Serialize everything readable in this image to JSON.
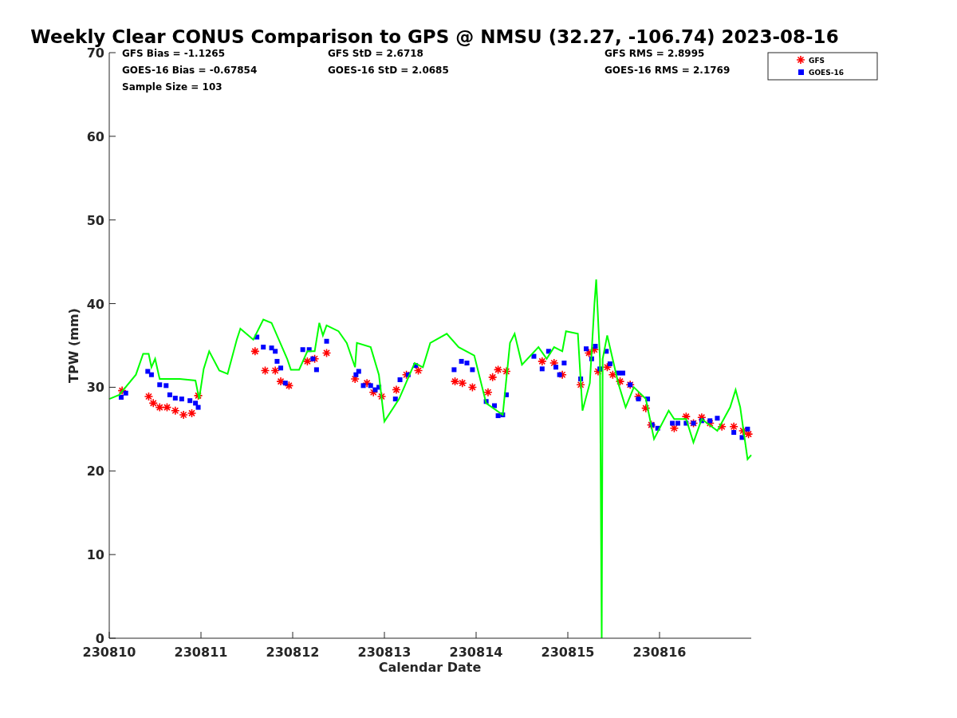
{
  "chart_data": {
    "type": "scatter",
    "title": "Weekly Clear CONUS Comparison to GPS @ NMSU (32.27, -106.74) 2023-08-16",
    "xlabel": "Calendar Date",
    "ylabel": "TPW (mm)",
    "xlim": [
      230810,
      230817
    ],
    "ylim": [
      0,
      70
    ],
    "xticks": [
      {
        "value": 230810,
        "label": "230810"
      },
      {
        "value": 230811,
        "label": "230811"
      },
      {
        "value": 230812,
        "label": "230812"
      },
      {
        "value": 230813,
        "label": "230813"
      },
      {
        "value": 230814,
        "label": "230814"
      },
      {
        "value": 230815,
        "label": "230815"
      },
      {
        "value": 230816,
        "label": "230816"
      }
    ],
    "yticks": [
      0,
      10,
      20,
      30,
      40,
      50,
      60,
      70
    ],
    "series": [
      {
        "name": "GFS",
        "type": "scatter",
        "color": "#ff0000",
        "x": [
          230810.14,
          230810.43,
          230810.48,
          230810.55,
          230810.63,
          230810.72,
          230810.81,
          230810.9,
          230810.97,
          230811.59,
          230811.7,
          230811.81,
          230811.87,
          230811.96,
          230812.16,
          230812.24,
          230812.37,
          230812.68,
          230812.81,
          230812.88,
          230812.97,
          230813.13,
          230813.24,
          230813.37,
          230813.77,
          230813.85,
          230813.96,
          230814.13,
          230814.18,
          230814.24,
          230814.33,
          230814.72,
          230814.85,
          230814.94,
          230815.14,
          230815.23,
          230815.29,
          230815.33,
          230815.43,
          230815.49,
          230815.57,
          230815.68,
          230815.77,
          230815.85,
          230815.91,
          230816.16,
          230816.29,
          230816.37,
          230816.46,
          230816.55,
          230816.68,
          230816.81,
          230816.91,
          230816.97
        ],
        "values": [
          29.6,
          28.9,
          28.1,
          27.6,
          27.6,
          27.2,
          26.7,
          26.9,
          29,
          34.3,
          32,
          32,
          30.7,
          30.2,
          33.1,
          33.4,
          34.1,
          31,
          30.5,
          29.4,
          28.9,
          29.7,
          31.5,
          32,
          30.7,
          30.5,
          30,
          29.4,
          31.2,
          32.1,
          31.9,
          33.1,
          32.9,
          31.5,
          30.3,
          34.1,
          34.5,
          31.9,
          32.4,
          31.5,
          30.7,
          30.3,
          28.9,
          27.5,
          25.5,
          25.1,
          26.5,
          25.7,
          26.4,
          25.7,
          25.3,
          25.3,
          24.8,
          24.4
        ]
      },
      {
        "name": "GOES-16",
        "type": "scatter",
        "color": "#0000ff",
        "x": [
          230810.13,
          230810.18,
          230810.42,
          230810.46,
          230810.55,
          230810.62,
          230810.66,
          230810.72,
          230810.79,
          230810.88,
          230810.94,
          230810.97,
          230811.61,
          230811.68,
          230811.77,
          230811.81,
          230811.83,
          230811.87,
          230811.92,
          230812.11,
          230812.18,
          230812.22,
          230812.26,
          230812.37,
          230812.69,
          230812.72,
          230812.77,
          230812.85,
          230812.9,
          230812.94,
          230813.12,
          230813.17,
          230813.26,
          230813.34,
          230813.76,
          230813.84,
          230813.9,
          230813.96,
          230814.11,
          230814.2,
          230814.24,
          230814.29,
          230814.33,
          230814.63,
          230814.72,
          230814.79,
          230814.87,
          230814.91,
          230814.96,
          230815.14,
          230815.2,
          230815.26,
          230815.3,
          230815.35,
          230815.42,
          230815.46,
          230815.55,
          230815.6,
          230815.68,
          230815.77,
          230815.87,
          230815.92,
          230815.98,
          230816.14,
          230816.2,
          230816.29,
          230816.37,
          230816.46,
          230816.55,
          230816.63,
          230816.81,
          230816.9,
          230816.96
        ],
        "values": [
          28.8,
          29.3,
          31.9,
          31.5,
          30.3,
          30.2,
          29.1,
          28.7,
          28.6,
          28.4,
          28.1,
          27.6,
          36,
          34.8,
          34.7,
          34.3,
          33.1,
          32.3,
          30.5,
          34.5,
          34.5,
          33.4,
          32.1,
          35.5,
          31.5,
          31.9,
          30.2,
          30.2,
          29.7,
          30,
          28.6,
          30.9,
          31.5,
          32.6,
          32.1,
          33.1,
          32.9,
          32.1,
          28.3,
          27.8,
          26.6,
          26.7,
          29.1,
          33.7,
          32.2,
          34.3,
          32.4,
          31.5,
          32.9,
          31,
          34.6,
          33.4,
          34.9,
          32.2,
          34.3,
          32.8,
          31.7,
          31.7,
          30.3,
          28.6,
          28.6,
          25.5,
          25.1,
          25.7,
          25.7,
          25.7,
          25.7,
          26,
          26,
          26.3,
          24.6,
          24,
          25
        ]
      },
      {
        "type": "line",
        "color": "#00ff00",
        "x": [
          230810,
          230810.11,
          230810.29,
          230810.37,
          230810.43,
          230810.46,
          230810.5,
          230810.55,
          230810.77,
          230810.94,
          230810.98,
          230811.03,
          230811.09,
          230811.2,
          230811.29,
          230811.39,
          230811.43,
          230811.57,
          230811.68,
          230811.77,
          230811.94,
          230811.98,
          230812.07,
          230812.16,
          230812.24,
          230812.29,
          230812.33,
          230812.37,
          230812.5,
          230812.59,
          230812.68,
          230812.7,
          230812.85,
          230812.94,
          230813,
          230813.16,
          230813.33,
          230813.42,
          230813.5,
          230813.68,
          230813.81,
          230813.98,
          230814.11,
          230814.29,
          230814.37,
          230814.42,
          230814.5,
          230814.68,
          230814.77,
          230814.85,
          230814.94,
          230814.98,
          230815.11,
          230815.16,
          230815.24,
          230815.29,
          230815.31,
          230815.35,
          230815.37,
          230815.38,
          230815.43,
          230815.55,
          230815.63,
          230815.72,
          230815.85,
          230815.94,
          230816.1,
          230816.16,
          230816.29,
          230816.37,
          230816.46,
          230816.63,
          230816.77,
          230816.83,
          230816.88,
          230816.96,
          230817
        ],
        "values": [
          28.6,
          29.1,
          31.5,
          34,
          34,
          32.4,
          33.4,
          31,
          31,
          30.8,
          28.6,
          32.2,
          34.3,
          32,
          31.6,
          35.7,
          37,
          35.7,
          38.1,
          37.7,
          33.4,
          32.1,
          32.1,
          34.3,
          34.3,
          37.7,
          36.2,
          37.4,
          36.7,
          35.3,
          32.4,
          35.3,
          34.8,
          31.5,
          25.9,
          28.6,
          32.9,
          32.4,
          35.3,
          36.4,
          34.8,
          33.8,
          28.1,
          26.7,
          35.3,
          36.4,
          32.7,
          34.8,
          33.4,
          34.8,
          34.3,
          36.7,
          36.4,
          27.2,
          30.5,
          40,
          42.9,
          33.4,
          0,
          33.4,
          36.2,
          30.5,
          27.6,
          30,
          28.6,
          23.8,
          27.2,
          26.2,
          26.2,
          23.4,
          26.2,
          24.8,
          27.6,
          29.7,
          27.6,
          21.4,
          21.9
        ]
      }
    ],
    "legend": "top-right-outside",
    "annotations": [
      "GFS Bias = -1.1265",
      "GFS StD = 2.6718",
      "GFS RMS = 2.8995",
      "GOES-16 Bias = -0.67854",
      "GOES-16 StD = 2.0685",
      "GOES-16 RMS = 2.1769",
      "Sample Size = 103"
    ]
  }
}
